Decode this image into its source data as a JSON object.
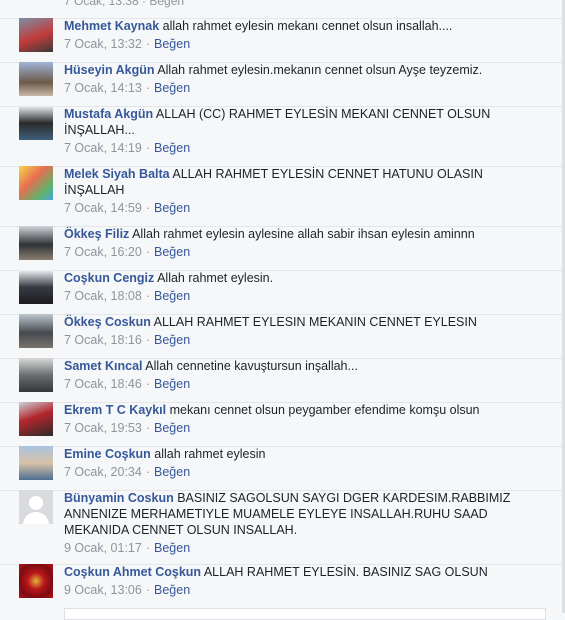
{
  "top_meta": "7 Ocak, 13:38 · Beğen",
  "like_label": "Beğen",
  "comments": [
    {
      "author": "Mehmet Kaynak",
      "text": "allah rahmet eylesin mekanı cennet olsun insallah....",
      "time": "7 Ocak, 13:32"
    },
    {
      "author": "Hüseyin Akgün",
      "text": "Allah rahmet eylesin.mekanın cennet olsun Ayşe teyzemiz.",
      "time": "7 Ocak, 14:13"
    },
    {
      "author": "Mustafa Akgün",
      "text": "ALLAH (CC) RAHMET EYLESİN MEKANI CENNET OLSUN İNŞALLAH...",
      "time": "7 Ocak, 14:19"
    },
    {
      "author": "Melek Siyah Balta",
      "text": "ALLAH RAHMET EYLESİN CENNET HATUNU OLASIN İNŞALLAH",
      "time": "7 Ocak, 14:59"
    },
    {
      "author": "Ökkeş Filiz",
      "text": "Allah rahmet eylesin aylesine allah sabir ihsan eylesin aminnn",
      "time": "7 Ocak, 16:20"
    },
    {
      "author": "Coşkun Cengiz",
      "text": "Allah rahmet eylesin.",
      "time": "7 Ocak, 18:08"
    },
    {
      "author": "Ökkeş Coskun",
      "text": "ALLAH RAHMET EYLESIN MEKANIN CENNET EYLESIN",
      "time": "7 Ocak, 18:16"
    },
    {
      "author": "Samet Kıncal",
      "text": "Allah cennetine kavuştursun inşallah...",
      "time": "7 Ocak, 18:46"
    },
    {
      "author": "Ekrem T C Kaykıl",
      "text": "mekanı cennet olsun peygamber efendime komşu olsun",
      "time": "7 Ocak, 19:53"
    },
    {
      "author": "Emine Coşkun",
      "text": "allah rahmet eylesin",
      "time": "7 Ocak, 20:34"
    },
    {
      "author": "Bünyamin Coskun",
      "text": "BASINIZ SAGOLSUN SAYGI DGER KARDESIM.RABBIMIZ ANNENIZE MERHAMETIYLE MUAMELE EYLEYE INSALLAH.RUHU SAAD MEKANIDA CENNET OLSUN INSALLAH.",
      "time": "9 Ocak, 01:17"
    },
    {
      "author": "Coşkun Ahmet Coşkun",
      "text": "ALLAH RAHMET EYLESİN. BASINIZ SAG OLSUN",
      "time": "9 Ocak, 13:06"
    }
  ]
}
